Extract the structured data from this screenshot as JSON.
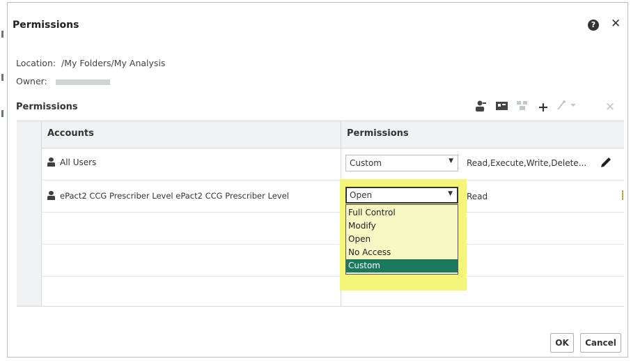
{
  "dialog": {
    "title": "Permissions",
    "help_icon": "help-icon",
    "close_icon": "close-icon"
  },
  "info": {
    "location_label": "Location:",
    "location_value": "/My Folders/My Analysis",
    "owner_label": "Owner:"
  },
  "permissions_section": {
    "heading": "Permissions",
    "toolbar_icons": [
      "add-user-icon",
      "add-application-role-icon",
      "add-group-icon",
      "add-icon",
      "wand-dropdown-icon",
      "delete-icon"
    ]
  },
  "table": {
    "columns": [
      "Accounts",
      "Permissions"
    ],
    "rows": [
      {
        "account": "All Users",
        "permission": "Custom",
        "summary": "Read,Execute,Write,Delete..."
      },
      {
        "account": "ePact2 CCG Prescriber Level ePact2 CCG Prescriber Level",
        "permission": "Open",
        "summary": "Read"
      }
    ]
  },
  "dropdown": {
    "options": [
      "Full Control",
      "Modify",
      "Open",
      "No Access",
      "Custom"
    ],
    "highlighted": "Custom",
    "highlight_color": "#1c7a5c",
    "callout_color": "#f5f57a"
  },
  "buttons": {
    "ok": "OK",
    "cancel": "Cancel"
  }
}
